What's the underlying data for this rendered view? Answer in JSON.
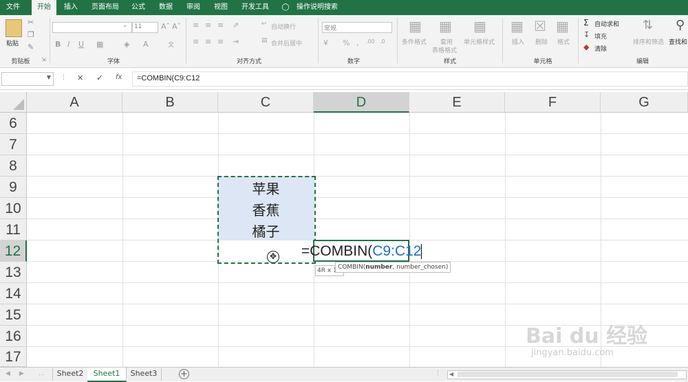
{
  "ribbon_tabs": [
    {
      "label": "文件"
    },
    {
      "label": "开始"
    },
    {
      "label": "插入"
    },
    {
      "label": "页面布局"
    },
    {
      "label": "公式"
    },
    {
      "label": "数据"
    },
    {
      "label": "审阅"
    },
    {
      "label": "视图"
    },
    {
      "label": "开发工具"
    }
  ],
  "tell_me": "操作说明搜索",
  "clipboard": {
    "paste": "粘贴",
    "group": "剪贴板"
  },
  "font": {
    "size": "11",
    "group": "字体"
  },
  "alignment": {
    "wrap": "自动换行",
    "merge": "合并后居中",
    "group": "对齐方式"
  },
  "number": {
    "format": "常规",
    "group": "数字"
  },
  "styles": {
    "conditional": "条件格式",
    "table1": "套用",
    "table2": "表格格式",
    "cell_styles": "单元格样式",
    "group": "样式"
  },
  "cells": {
    "insert": "插入",
    "delete": "删除",
    "format": "格式",
    "group": "单元格"
  },
  "editing": {
    "autosum": "自动求和",
    "fill": "填充",
    "clear": "清除",
    "sort": "排序和筛选",
    "find": "查找和",
    "group": "编辑"
  },
  "formula_bar": {
    "name_box": "",
    "cancel": "✕",
    "enter": "✓",
    "fx": "fx",
    "formula": "=COMBIN(C9:C12"
  },
  "columns": [
    "A",
    "B",
    "C",
    "D",
    "E",
    "F",
    "G"
  ],
  "rows": [
    "6",
    "7",
    "8",
    "9",
    "10",
    "11",
    "12",
    "13",
    "14",
    "15",
    "16",
    "17"
  ],
  "cells_data": {
    "c9": "苹果",
    "c10": "香蕉",
    "c11": "橘子"
  },
  "edit_cell": {
    "prefix": "=COMBIN(",
    "ref": "C9:C12"
  },
  "selection_hint": "4R x 1",
  "tooltip": {
    "fn": "COMBIN(",
    "arg1": "number",
    "rest": ", number_chosen)"
  },
  "sheets": [
    {
      "label": "Sheet2"
    },
    {
      "label": "Sheet1"
    },
    {
      "label": "Sheet3"
    }
  ],
  "add_sheet": "+",
  "watermark": {
    "logo": "Bai du 经验",
    "url": "jingyan.baidu.com"
  },
  "colors": {
    "accent": "#217346",
    "ref_blue": "#1f6fc4"
  }
}
